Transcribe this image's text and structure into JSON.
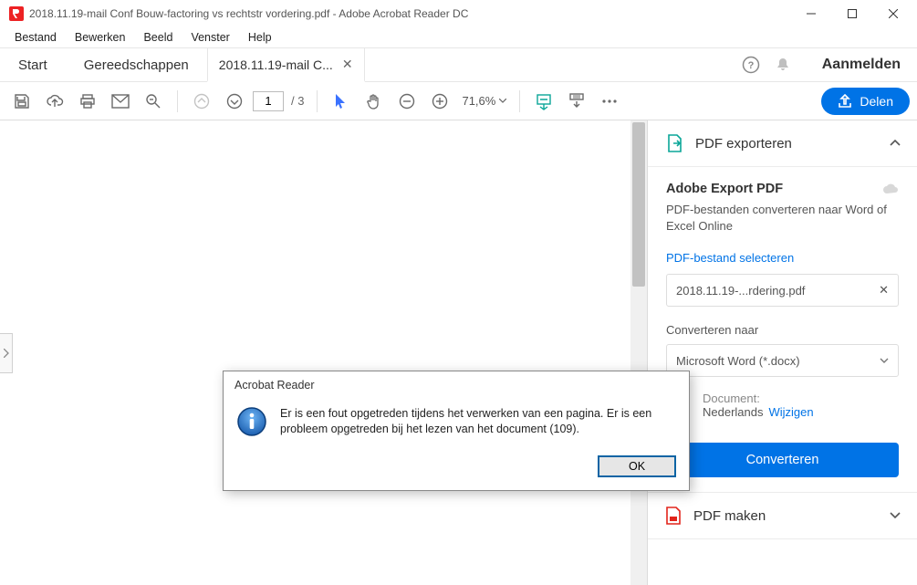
{
  "window": {
    "title": "2018.11.19-mail Conf Bouw-factoring vs rechtstr vordering.pdf - Adobe Acrobat Reader DC"
  },
  "menu": {
    "file": "Bestand",
    "edit": "Bewerken",
    "view": "Beeld",
    "window": "Venster",
    "help": "Help"
  },
  "tabs": {
    "start": "Start",
    "tools": "Gereedschappen",
    "doc": "2018.11.19-mail C...",
    "signin": "Aanmelden"
  },
  "toolbar": {
    "page_current": "1",
    "page_total": "/  3",
    "zoom": "71,6%",
    "share": "Delen"
  },
  "rpanel": {
    "export_title": "PDF exporteren",
    "aep_title": "Adobe Export PDF",
    "aep_desc": "PDF-bestanden converteren naar Word of Excel Online",
    "select_label": "PDF-bestand selecteren",
    "file_name": "2018.11.19-...rdering.pdf",
    "convert_to_label": "Converteren naar",
    "convert_to_value": "Microsoft Word (*.docx)",
    "doclang_label": "Document:",
    "doclang_value": "Nederlands",
    "doclang_change": "Wijzigen",
    "convert_btn": "Converteren",
    "make_title": "PDF maken"
  },
  "dialog": {
    "title": "Acrobat Reader",
    "message": "Er is een fout opgetreden tijdens het verwerken van een pagina. Er is een probleem opgetreden bij het lezen van het document (109).",
    "ok": "OK"
  }
}
